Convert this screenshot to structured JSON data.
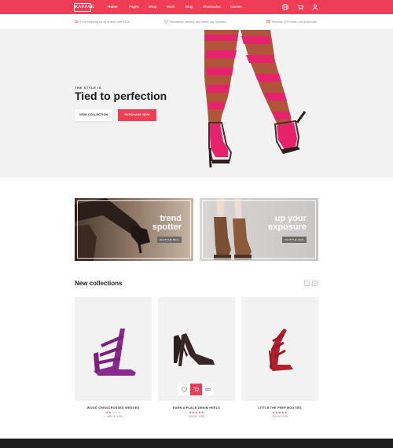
{
  "header": {
    "logo": "KAFFAR",
    "nav": [
      "Home",
      "Pages",
      "Shop",
      "Work",
      "Blog",
      "Shortcodes",
      "Games"
    ],
    "icons": [
      "globe-icon",
      "cart-icon",
      "user-icon"
    ]
  },
  "info_bar": [
    {
      "icon": "truck-icon",
      "text": "Free shipping on all orders over $100"
    },
    {
      "icon": "heart-icon",
      "text": "Worldwide delivery and same day dispatch"
    },
    {
      "icon": "mail-icon",
      "text": "Receive 10% when you subscribe"
    }
  ],
  "hero": {
    "eyebrow": "THE STYLE IS",
    "headline": "Tied to perfection",
    "btn_view": "VIEW COLLECTION",
    "btn_purchase": "PURCHASE NOW"
  },
  "banners": [
    {
      "title_line1": "trend",
      "title_line2": "spotter",
      "button": "SHOP THE DEAL"
    },
    {
      "title_line1": "up your",
      "title_line2": "exposure",
      "button": "SHOP THE DEAL"
    }
  ],
  "collections": {
    "title": "New collections",
    "prev": "‹",
    "next": "›",
    "products": [
      {
        "name": "WOOD CRISSCROSSED WEDGES",
        "stars": "★★☆☆☆",
        "price": "— 448.00 USD"
      },
      {
        "name": "EARN A PLACE DENIM HEELS",
        "stars": "★★★★★",
        "price": "180.00 USD"
      },
      {
        "name": "LITTLE THE PEEP BOOTIES",
        "stars": "★★★★★",
        "price": "220.00 USD"
      }
    ]
  },
  "colors": {
    "accent": "#ef3d55",
    "dark": "#1e1e1e",
    "hero_bg": "#f3f2f2"
  }
}
